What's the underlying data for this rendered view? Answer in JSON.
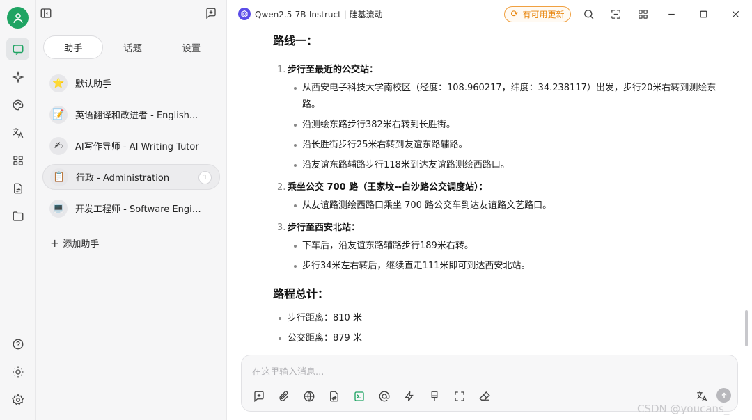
{
  "window": {
    "title": "Qwen2.5-7B-Instruct | 硅基流动",
    "update_button": "有可用更新"
  },
  "rail": {
    "icons": [
      "avatar-icon",
      "chat-icon",
      "sparkle-icon",
      "palette-icon",
      "translate-icon",
      "apps-icon",
      "file-swap-icon",
      "folder-icon",
      "help-icon",
      "theme-icon",
      "settings-icon"
    ]
  },
  "panel": {
    "tabs": [
      "助手",
      "话题",
      "设置"
    ],
    "agents": [
      {
        "icon": "⭐",
        "name": "默认助手"
      },
      {
        "icon": "📝",
        "name": "英语翻译和改进者 - English..."
      },
      {
        "icon": "✍",
        "name": "AI写作导师 - AI Writing Tutor"
      },
      {
        "icon": "📋",
        "name": "行政 - Administration",
        "badge": "1"
      },
      {
        "icon": "💻",
        "name": "开发工程师 - Software Engineer"
      }
    ],
    "add_agent": "添加助手"
  },
  "message": {
    "route_title": "路线一：",
    "steps": [
      {
        "num": "1.",
        "title": "步行至最近的公交站：",
        "items": [
          "从西安电子科技大学南校区（经度：108.960217，纬度：34.238117）出发，步行20米右转到测绘东路。",
          "沿测绘东路步行382米右转到长胜街。",
          "沿长胜街步行25米右转到友谊东路辅路。",
          "沿友谊东路辅路步行118米到达友谊路测绘西路口。"
        ]
      },
      {
        "num": "2.",
        "title": "乘坐公交 700 路（王家坟--白沙路公交调度站）：",
        "items": [
          "从友谊路测绘西路口乘坐 700 路公交车到达友谊路文艺路口。"
        ]
      },
      {
        "num": "3.",
        "title": "步行至西安北站：",
        "items": [
          "下车后，沿友谊东路辅路步行189米右转。",
          "步行34米左右转后，继续直走111米即可到达西安北站。"
        ]
      }
    ],
    "total_title": "路程总计：",
    "totals": [
      "步行距离：810 米",
      "公交距离：879 米"
    ]
  },
  "input": {
    "placeholder": "在这里输入消息..."
  },
  "watermark": "CSDN @youcans_"
}
